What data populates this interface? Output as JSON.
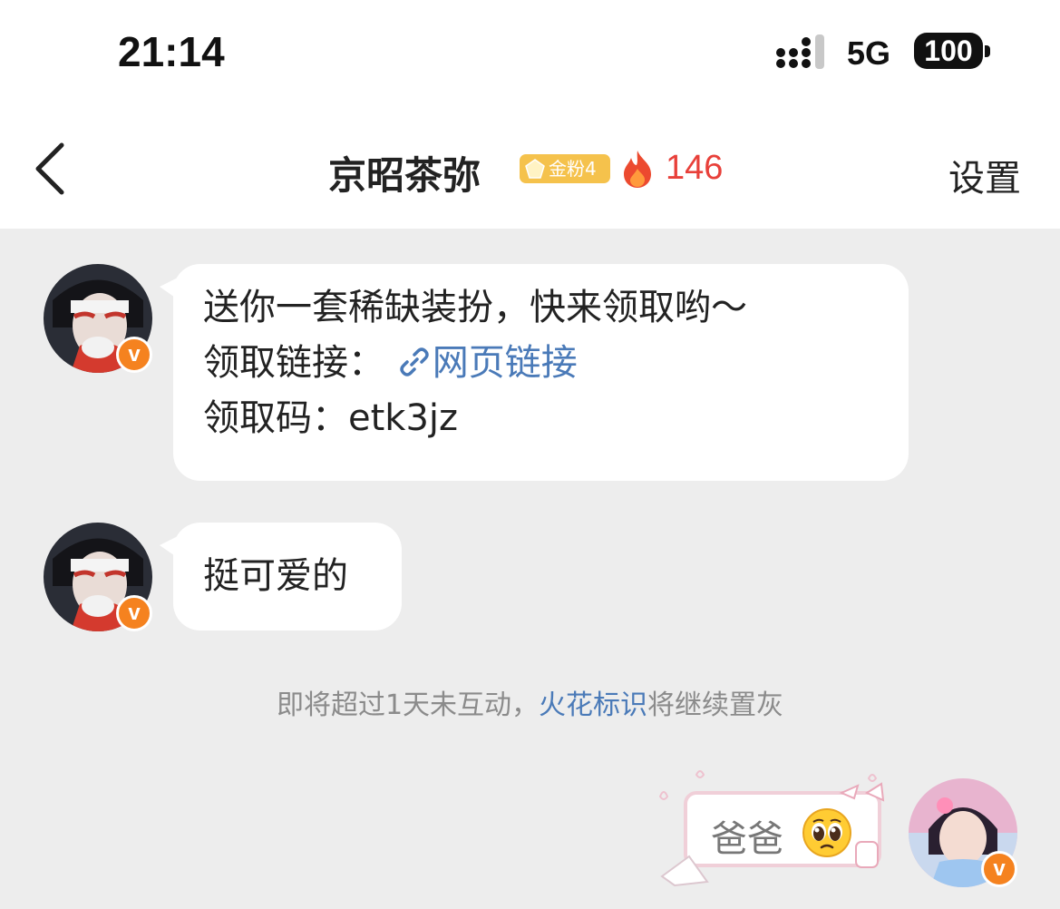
{
  "status_bar": {
    "time": "21:14",
    "network": "5G",
    "battery": "100"
  },
  "nav": {
    "title": "京昭茶弥",
    "fan_badge": "金粉4",
    "fire_count": "146",
    "settings_label": "设置"
  },
  "messages": [
    {
      "sender": "other",
      "lines": {
        "line1": "送你一套稀缺装扮，快来领取哟～",
        "line2_label": "领取链接：",
        "line2_link": "网页链接",
        "line3": "领取码：etk3jz"
      }
    },
    {
      "sender": "other",
      "text": "挺可爱的"
    }
  ],
  "notice": {
    "prefix": "即将超过1天未互动，",
    "highlight": "火花标识",
    "suffix": "将继续置灰"
  },
  "my_message": {
    "text": "爸爸"
  },
  "colors": {
    "fire": "#e8403a",
    "link": "#4a7ab8",
    "verified_badge": "#f5821f",
    "fan_badge": "#f5c24c"
  }
}
